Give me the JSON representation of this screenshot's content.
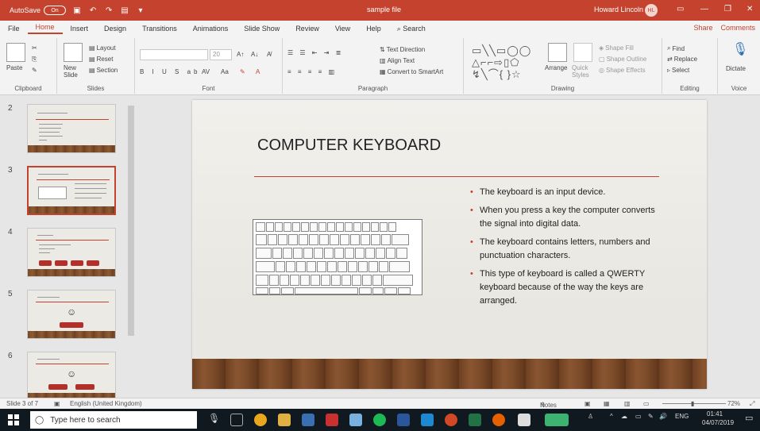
{
  "titlebar": {
    "autosave_label": "AutoSave",
    "autosave_state": "On",
    "doc_title": "sample file",
    "user_name": "Howard Lincoln",
    "user_initials": "HL"
  },
  "ribbon_tabs": [
    "File",
    "Home",
    "Insert",
    "Design",
    "Transitions",
    "Animations",
    "Slide Show",
    "Review",
    "View",
    "Help",
    "Search"
  ],
  "ribbon_right": {
    "share": "Share",
    "comments": "Comments"
  },
  "ribbon": {
    "clipboard": {
      "paste": "Paste",
      "label": "Clipboard"
    },
    "slides": {
      "new_slide": "New Slide",
      "layout": "Layout",
      "reset": "Reset",
      "section": "Section",
      "label": "Slides"
    },
    "font": {
      "size": "20",
      "label": "Font"
    },
    "paragraph": {
      "text_direction": "Text Direction",
      "align_text": "Align Text",
      "convert_smartart": "Convert to SmartArt",
      "label": "Paragraph"
    },
    "drawing": {
      "arrange": "Arrange",
      "quick_styles": "Quick Styles",
      "shape_fill": "Shape Fill",
      "shape_outline": "Shape Outline",
      "shape_effects": "Shape Effects",
      "label": "Drawing"
    },
    "editing": {
      "find": "Find",
      "replace": "Replace",
      "select": "Select",
      "label": "Editing"
    },
    "voice": {
      "dictate": "Dictate",
      "label": "Voice"
    }
  },
  "thumbnails": [
    {
      "num": "2"
    },
    {
      "num": "3"
    },
    {
      "num": "4"
    },
    {
      "num": "5"
    },
    {
      "num": "6"
    }
  ],
  "slide": {
    "title": "COMPUTER KEYBOARD",
    "bullets": [
      "The keyboard is an input device.",
      "When you press a key the computer converts the signal into digital data.",
      "The keyboard contains letters, numbers and punctuation characters.",
      "This type of keyboard is called a QWERTY keyboard because of the way the keys are arranged."
    ]
  },
  "statusbar": {
    "slide_count": "Slide 3 of 7",
    "language": "English (United Kingdom)",
    "notes": "Notes",
    "zoom": "72%"
  },
  "taskbar": {
    "search_placeholder": "Type here to search",
    "time": "01:41",
    "date": "04/07/2019",
    "lang": "ENG"
  }
}
